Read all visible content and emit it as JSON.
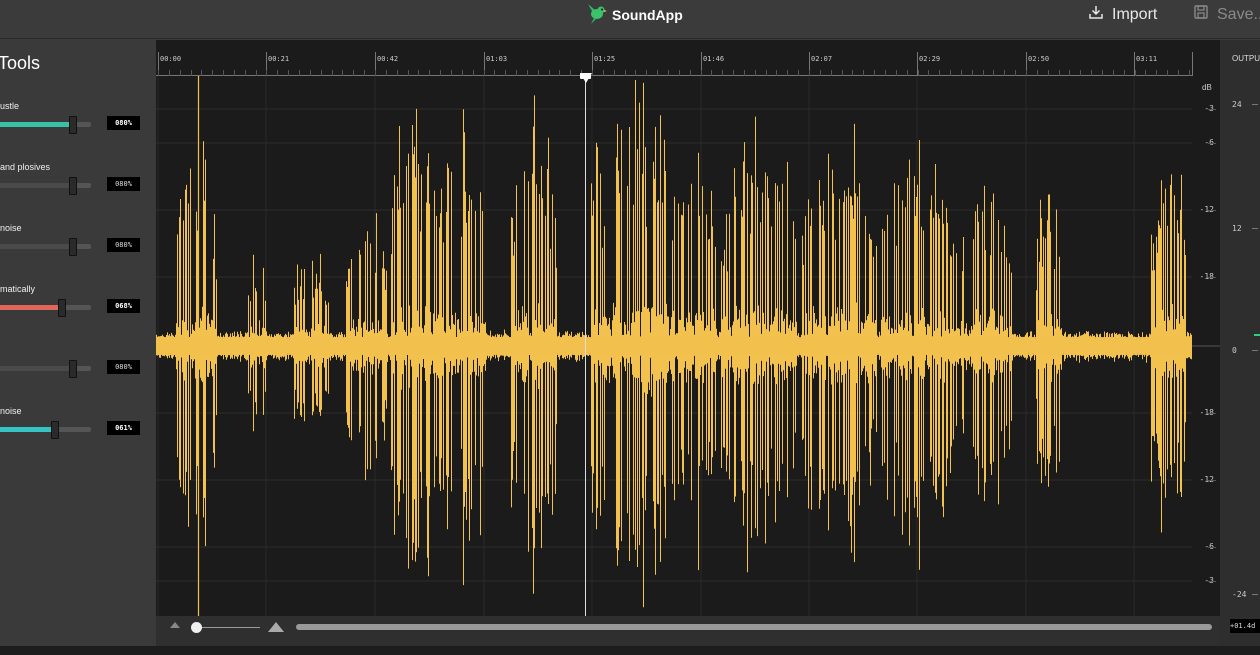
{
  "app": {
    "name": "SoundApp",
    "logo_icon": "bird-logo-icon",
    "accent": "#3ac16a"
  },
  "header": {
    "import_label": "Import",
    "save_label": "Save..."
  },
  "tools": {
    "title": "Tools",
    "items": [
      {
        "label": "ustle",
        "value_text": "080%",
        "level": 0.8,
        "color": "#36c3a8",
        "bright": true
      },
      {
        "label": "and plosives",
        "value_text": "080%",
        "level": 0.8,
        "color": "#4a4a4a",
        "bright": false
      },
      {
        "label": " noise",
        "value_text": "080%",
        "level": 0.8,
        "color": "#4a4a4a",
        "bright": false
      },
      {
        "label": "matically",
        "value_text": "068%",
        "level": 0.68,
        "color": "#e0655a",
        "bright": true
      },
      {
        "label": "",
        "value_text": "080%",
        "level": 0.8,
        "color": "#4a4a4a",
        "bright": false
      },
      {
        "label": "noise",
        "value_text": "061%",
        "level": 0.61,
        "color": "#36c3c3",
        "bright": true
      }
    ]
  },
  "timeline": {
    "labels": [
      "00:00",
      "00:21",
      "00:42",
      "01:03",
      "01:25",
      "01:46",
      "02:07",
      "02:29",
      "02:50",
      "03:11"
    ],
    "playhead_time": "01:25"
  },
  "db_scale": {
    "unit": "dB",
    "labels": [
      "-3",
      "-6",
      "-12",
      "-18",
      "-18",
      "-12",
      "-6",
      "-3"
    ]
  },
  "waveform": {
    "color": "#f2c14e"
  },
  "output": {
    "title": "OUTPU",
    "labels": [
      "24",
      "12",
      "0",
      "-24"
    ],
    "value_text": "+01.4d"
  }
}
